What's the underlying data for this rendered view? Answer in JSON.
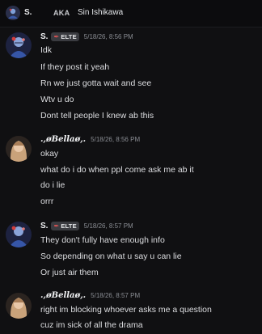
{
  "topbar": {
    "name": "S.",
    "aka_label": "AKA",
    "nickname": "Sin Ishikawa"
  },
  "messages": [
    {
      "author": "S.",
      "tag": "ELTE",
      "timestamp": "5/18/26, 8:56 PM",
      "lines": [
        "Idk",
        "If they post it yeah",
        "Rn we just gotta wait and see",
        "Wtv u do",
        "Dont tell people I knew ab this"
      ]
    },
    {
      "author": ".,øBellaø,.",
      "timestamp": "5/18/26, 8:56 PM",
      "lines": [
        "okay",
        "what do i do when ppl come ask me ab it",
        "do i lie",
        "orrr"
      ]
    },
    {
      "author": "S.",
      "tag": "ELTE",
      "timestamp": "5/18/26, 8:57 PM",
      "lines": [
        "They don't fully have enough info",
        "So depending on what u say u can lie",
        "Or just air them"
      ]
    },
    {
      "author": ".,øBellaø,.",
      "timestamp": "5/18/26, 8:57 PM",
      "lines": [
        "right im blocking whoever asks me a question",
        "cuz im sick of all the drama"
      ]
    }
  ],
  "colors": {
    "background": "#101012",
    "text": "#dcdde0",
    "timestamp": "#8a8d93",
    "tag_bg": "#3a3b40"
  },
  "icons": {
    "tag_icon": "quill-icon"
  }
}
